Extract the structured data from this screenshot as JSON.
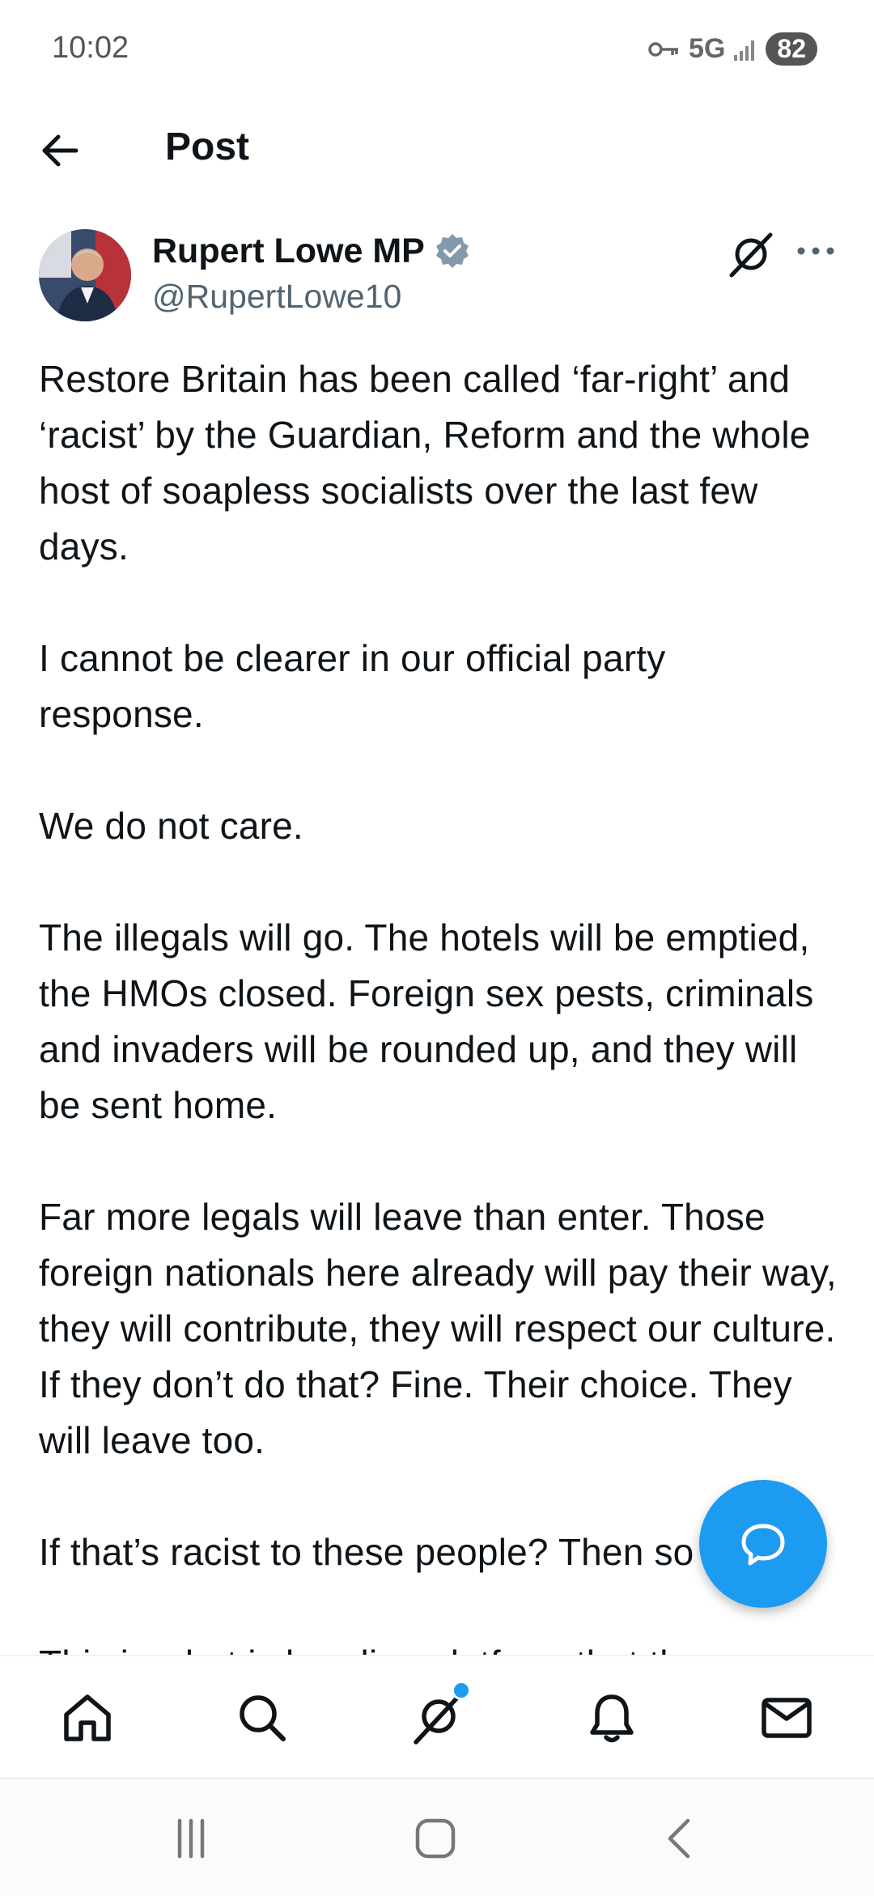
{
  "status_bar": {
    "time": "10:02",
    "network": "5G",
    "battery": "82"
  },
  "header": {
    "title": "Post",
    "back_icon": "arrow-left-icon"
  },
  "post": {
    "author_name": "Rupert Lowe MP",
    "author_handle": "@RupertLowe10",
    "verified_icon": "verified-badge-icon",
    "text": "Restore Britain has been called ‘far-right’ and ‘racist’ by the Guardian, Reform and the whole host of soapless socialists over the last few days.\n\nI cannot be clearer in our official party response.\n\nWe do not care.\n\nThe illegals will go. The hotels will be emptied, the HMOs closed. Foreign sex pests, criminals and invaders will be rounded up, and they will be sent home.\n\nFar more legals will leave than enter. Those foreign nationals here already will pay their way, they will contribute, they will respect our culture. If they don’t do that? Fine. Their choice. They will leave too.\n\nIf that’s racist to these people? Then so be it.\n\nThis is what is heading platform that they"
  },
  "bottom_nav": {
    "items": [
      "home-icon",
      "search-icon",
      "grok-icon",
      "notifications-icon",
      "messages-icon"
    ]
  },
  "colors": {
    "accent": "#1d9bf0",
    "text": "#0f1419",
    "secondary_text": "#536471"
  }
}
